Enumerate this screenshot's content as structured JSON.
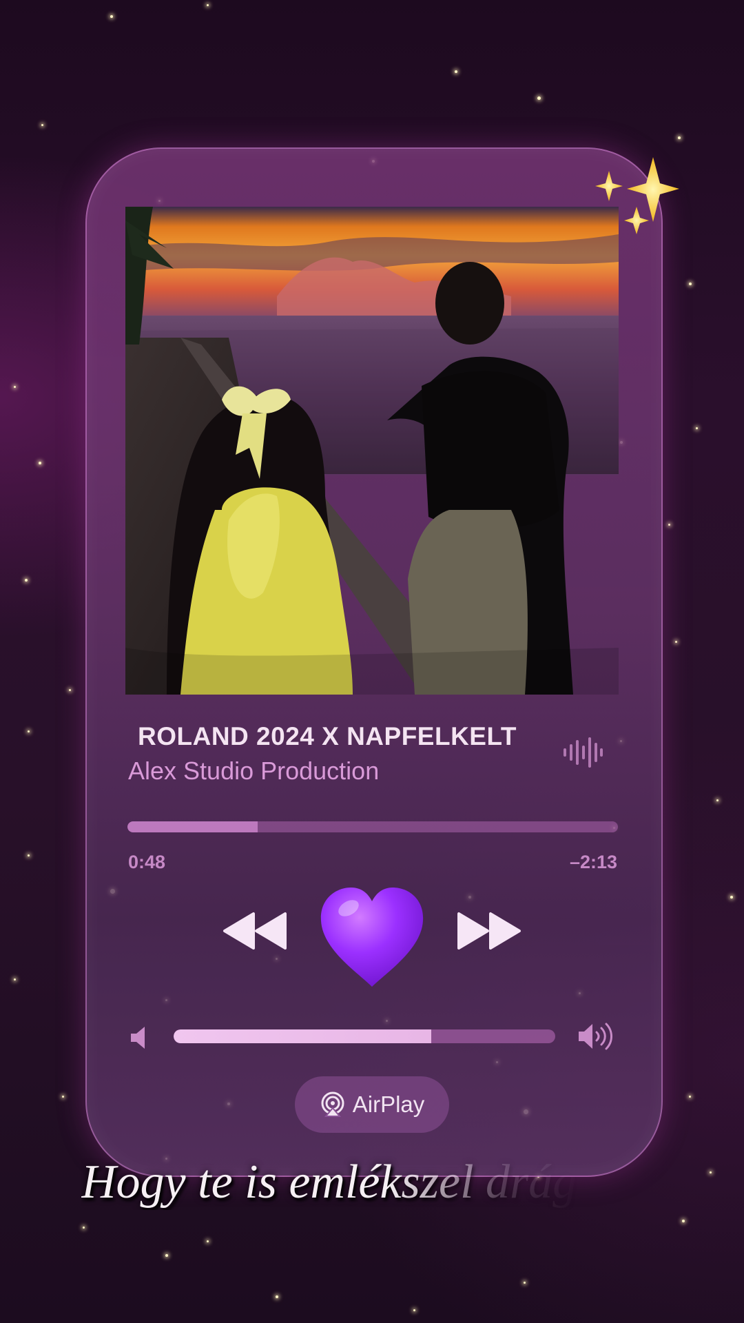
{
  "track": {
    "title": "ROLAND 2024 X NAPFELKELT",
    "artist": "Alex Studio Production"
  },
  "playback": {
    "elapsed": "0:48",
    "remaining": "–2:13",
    "progress_fraction": 0.265
  },
  "volume": {
    "level_fraction": 0.675
  },
  "output": {
    "airplay_label": "AirPlay"
  },
  "lyric": {
    "text": "Hogy te is emlékszel drága"
  },
  "icons": {
    "sparkles": "sparkles-icon",
    "waveform": "waveform-icon",
    "rewind": "rewind-icon",
    "heart": "purple-heart-icon",
    "forward": "fast-forward-icon",
    "volume_low": "speaker-low-icon",
    "volume_high": "speaker-high-icon",
    "airplay": "airplay-icon"
  },
  "colors": {
    "accent": "#9b30ff",
    "title": "#f4e4f2",
    "artist": "#d99ad8",
    "time": "#c689c6"
  }
}
